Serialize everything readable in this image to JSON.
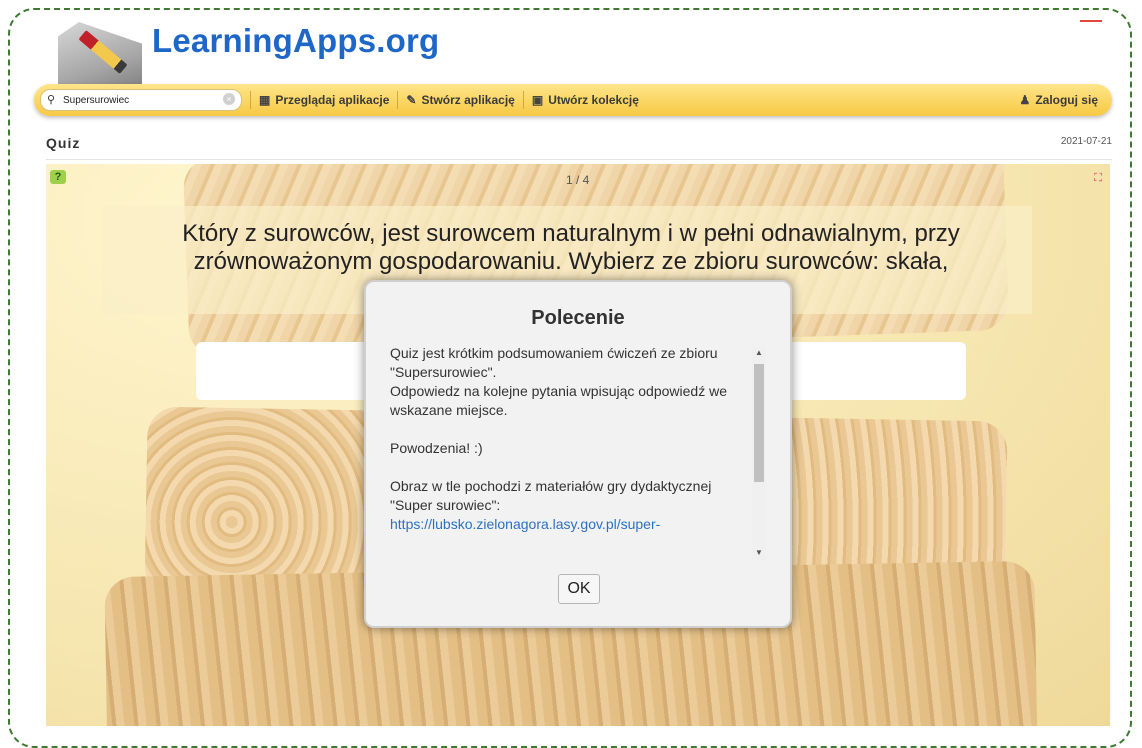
{
  "header": {
    "logo_text": "LearningApps.org"
  },
  "navbar": {
    "search_value": "Supersurowiec",
    "browse_label": "Przeglądaj aplikacje",
    "create_label": "Stwórz aplikację",
    "collection_label": "Utwórz kolekcję",
    "login_label": "Zaloguj się"
  },
  "page": {
    "title": "Quiz",
    "date": "2021-07-21"
  },
  "quiz": {
    "counter": "1 / 4",
    "question": "Który z surowców, jest surowcem naturalnym i w pełni odnawialnym, przy zrównoważonym gospodarowaniu. Wybierz ze zbioru surowców: skała,"
  },
  "modal": {
    "title": "Polecenie",
    "line1": "Quiz jest krótkim podsumowaniem ćwiczeń ze zbioru \"Supersurowiec\".",
    "line2": "Odpowiedz na kolejne pytania wpisując odpowiedź we wskazane miejsce.",
    "line3": "Powodzenia! :)",
    "line4": "Obraz w tle pochodzi z materiałów gry dydaktycznej \"Super surowiec\":",
    "link": "https://lubsko.zielonagora.lasy.gov.pl/super-",
    "ok_label": "OK"
  },
  "icons": {
    "search": "search-icon",
    "clear": "clear-icon",
    "grid": "grid-icon",
    "pencil": "pencil-icon",
    "collection": "collection-icon",
    "user": "user-icon",
    "help": "help-icon",
    "fullscreen": "fullscreen-icon"
  }
}
